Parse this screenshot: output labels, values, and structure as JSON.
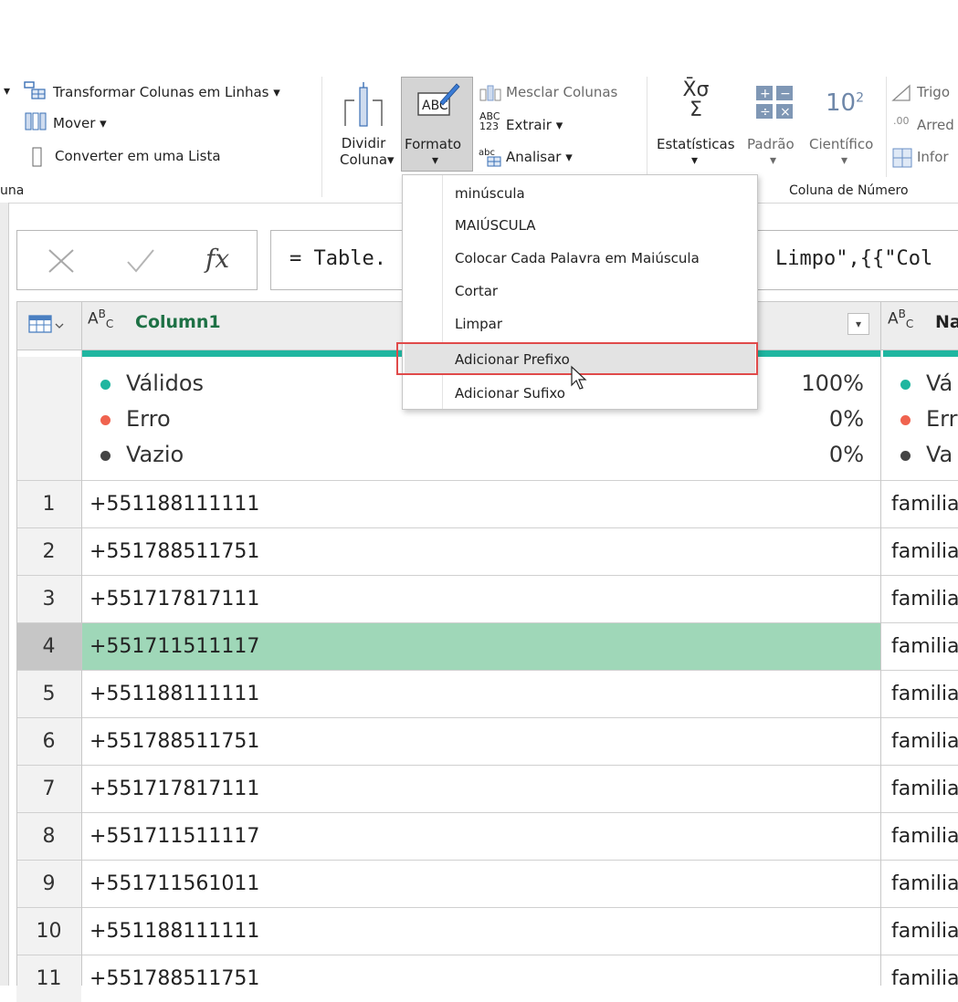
{
  "ribbon": {
    "transform_rows": "Transformar Colunas em Linhas",
    "move": "Mover",
    "convert_list": "Converter em uma Lista",
    "group_label_left": "una",
    "split_col_line1": "Dividir",
    "split_col_line2": "Coluna",
    "format": "Formato",
    "merge_cols": "Mesclar Colunas",
    "extract": "Extrair",
    "parse": "Analisar",
    "statistics": "Estatísticas",
    "standard": "Padrão",
    "scientific": "Científico",
    "trig": "Trigo",
    "round": "Arred",
    "info": "Infor",
    "number_group": "Coluna de Número",
    "abc_123": "ABC\n123",
    "abc_small": "abc",
    "ten": "10",
    "exp": "2"
  },
  "formula": {
    "left": "= Table.",
    "right": "Limpo\",{{\"Col"
  },
  "menu": {
    "items": [
      "minúscula",
      "MAIÚSCULA",
      "Colocar Cada Palavra em Maiúscula",
      "Cortar",
      "Limpar",
      "Adicionar Prefixo",
      "Adicionar Sufixo"
    ],
    "highlighted": "Adicionar Prefixo"
  },
  "grid": {
    "col1_name": "Column1",
    "col2_name": "Na",
    "stats": {
      "valid": "Válidos",
      "valid_pct": "100%",
      "error": "Erro",
      "error_pct": "0%",
      "empty": "Vazio",
      "empty_pct": "0%",
      "valid2": "Vá",
      "error2": "Err",
      "empty2": "Va"
    },
    "rows": [
      {
        "n": "1",
        "v": "+551188111111",
        "c2": "familia"
      },
      {
        "n": "2",
        "v": "+551788511751",
        "c2": "familia"
      },
      {
        "n": "3",
        "v": "+551717817111",
        "c2": "familia"
      },
      {
        "n": "4",
        "v": "+551711511117",
        "c2": "familia"
      },
      {
        "n": "5",
        "v": "+551188111111",
        "c2": "familia"
      },
      {
        "n": "6",
        "v": "+551788511751",
        "c2": "familia"
      },
      {
        "n": "7",
        "v": "+551717817111",
        "c2": "familia"
      },
      {
        "n": "8",
        "v": "+551711511117",
        "c2": "familia"
      },
      {
        "n": "9",
        "v": "+551711561011",
        "c2": "familia"
      },
      {
        "n": "10",
        "v": "+551188111111",
        "c2": "familia"
      },
      {
        "n": "11",
        "v": "+551788511751",
        "c2": "familia"
      }
    ],
    "selected_row": "4"
  },
  "colors": {
    "valid": "#1fb6a0",
    "error": "#f0634f",
    "empty": "#444444",
    "selected_cell": "#9fd7b8",
    "highlight_box": "#e04a4a"
  }
}
